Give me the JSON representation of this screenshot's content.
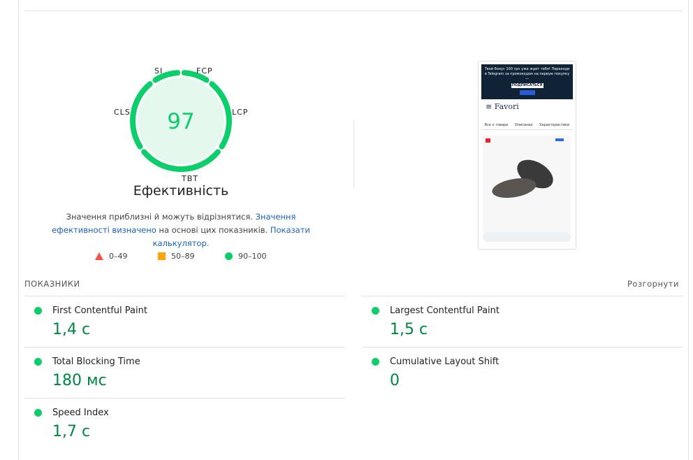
{
  "gauge": {
    "score": 97,
    "score_label": "97",
    "title": "Ефективність",
    "segments": {
      "si": "SI",
      "fcp": "FCP",
      "lcp": "LCP",
      "tbt": "TBT",
      "cls": "CLS"
    },
    "color": "#0cce6b",
    "fill": "#e5f8ee"
  },
  "description": {
    "text1": "Значення приблизні й можуть відрізнятися. ",
    "link1": "Значення ефективності визначено",
    "text2": " на основі цих показників. ",
    "link2": "Показати калькулятор."
  },
  "legend": [
    {
      "range": "0–49",
      "color": "#ff4e42",
      "shape": "triangle"
    },
    {
      "range": "50–89",
      "color": "#ffa400",
      "shape": "square"
    },
    {
      "range": "90–100",
      "color": "#0cce6b",
      "shape": "circle"
    }
  ],
  "screenshot": {
    "banner": "Твой бонус 100 грн уже ждет тебя! Переходи в Telegram за промокодом на первую покупку —",
    "subscribe": "ПОДПИСАТЬСЯ",
    "brand": "Favori",
    "tabs": [
      "Все о товаре",
      "Описание",
      "Характеристики"
    ]
  },
  "metrics": {
    "section_label": "ПОКАЗНИКИ",
    "expand_label": "Розгорнути",
    "items": [
      {
        "name": "First Contentful Paint",
        "value": "1,4 с",
        "status": "good"
      },
      {
        "name": "Largest Contentful Paint",
        "value": "1,5 с",
        "status": "good"
      },
      {
        "name": "Total Blocking Time",
        "value": "180 мс",
        "status": "good"
      },
      {
        "name": "Cumulative Layout Shift",
        "value": "0",
        "status": "good"
      },
      {
        "name": "Speed Index",
        "value": "1,7 с",
        "status": "good"
      }
    ]
  }
}
